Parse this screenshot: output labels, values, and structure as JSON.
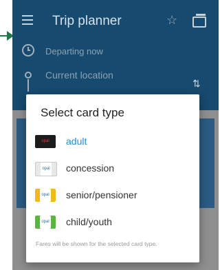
{
  "app": {
    "title": "Trip planner"
  },
  "trip": {
    "departing": "Departing now",
    "from_placeholder": "Current location"
  },
  "dialog": {
    "title": "Select card type",
    "options": [
      {
        "label": "adult",
        "selected": true,
        "card_color": "#1c1c1c"
      },
      {
        "label": "concession",
        "selected": false,
        "card_color": "#e8e8e8"
      },
      {
        "label": "senior/pensioner",
        "selected": false,
        "card_color": "#f2b91a"
      },
      {
        "label": "child/youth",
        "selected": false,
        "card_color": "#58b63f"
      }
    ],
    "note": "Fares will be shown for the selected card type."
  },
  "icons": {
    "menu": "hamburger-icon",
    "favourite": "star-icon",
    "cards": "cards-icon",
    "time": "clock-icon",
    "location": "location-pin-icon",
    "swap": "swap-icon",
    "pointer": "arrow-icon"
  },
  "colors": {
    "accent": "#1e8fd6",
    "topbar": "#164a6e",
    "card_panel": "#2b5b82"
  }
}
